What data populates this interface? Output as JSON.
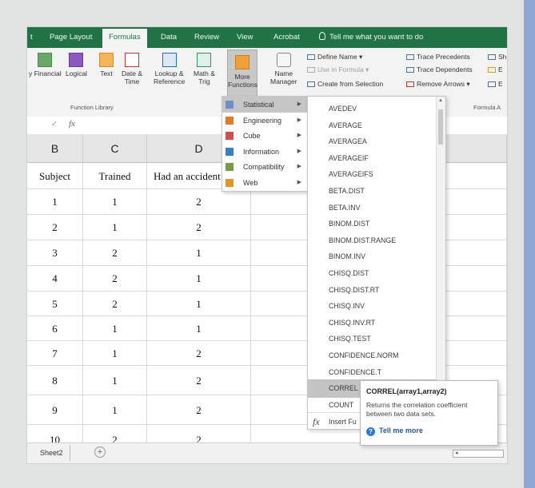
{
  "ribbon": {
    "tabs": [
      "t",
      "Page Layout",
      "Formulas",
      "Data",
      "Review",
      "View",
      "Acrobat"
    ],
    "active_tab": "Formulas",
    "tell_me": "Tell me what you want to do",
    "buttons": {
      "financial": "y Financial",
      "logical": "Logical",
      "text": "Text",
      "date_time_1": "Date &",
      "date_time_2": "Time",
      "lookup_1": "Lookup &",
      "lookup_2": "Reference",
      "math_1": "Math &",
      "math_2": "Trig",
      "more_1": "More",
      "more_2": "Functions",
      "name_mgr_1": "Name",
      "name_mgr_2": "Manager"
    },
    "defined_names": {
      "define": "Define Name",
      "use": "Use in Formula",
      "create": "Create from Selection"
    },
    "auditing": {
      "precedents": "Trace Precedents",
      "dependents": "Trace Dependents",
      "remove": "Remove Arrows",
      "sh": "Sh",
      "e1": "E",
      "e2": "E"
    },
    "group_labels": {
      "function_library": "Function Library",
      "formula_auditing": "Formula A"
    }
  },
  "formula_bar": {
    "check": "✓",
    "fx": "fx"
  },
  "grid": {
    "columns": [
      "B",
      "C",
      "D"
    ],
    "header": [
      "Subject",
      "Trained",
      "Had an accident"
    ],
    "rows": [
      [
        "1",
        "1",
        "2"
      ],
      [
        "2",
        "1",
        "2"
      ],
      [
        "3",
        "2",
        "1"
      ],
      [
        "4",
        "2",
        "1"
      ],
      [
        "5",
        "2",
        "1"
      ],
      [
        "6",
        "1",
        "1"
      ],
      [
        "7",
        "1",
        "2"
      ],
      [
        "8",
        "1",
        "2"
      ],
      [
        "9",
        "1",
        "2"
      ],
      [
        "10",
        "2",
        "2"
      ]
    ]
  },
  "more_functions_menu": [
    {
      "label": "Statistical",
      "icon": "statistical-icon",
      "color": "#6f8fc9"
    },
    {
      "label": "Engineering",
      "icon": "engineering-icon",
      "color": "#e07b2a"
    },
    {
      "label": "Cube",
      "icon": "cube-icon",
      "color": "#d05050"
    },
    {
      "label": "Information",
      "icon": "information-icon",
      "color": "#3a7fc1"
    },
    {
      "label": "Compatibility",
      "icon": "compatibility-icon",
      "color": "#7a9a4a"
    },
    {
      "label": "Web",
      "icon": "web-icon",
      "color": "#e0962a"
    }
  ],
  "statistical_functions": [
    "AVEDEV",
    "AVERAGE",
    "AVERAGEA",
    "AVERAGEIF",
    "AVERAGEIFS",
    "BETA.DIST",
    "BETA.INV",
    "BINOM.DIST",
    "BINOM.DIST.RANGE",
    "BINOM.INV",
    "CHISQ.DIST",
    "CHISQ.DIST.RT",
    "CHISQ.INV",
    "CHISQ.INV.RT",
    "CHISQ.TEST",
    "CONFIDENCE.NORM",
    "CONFIDENCE.T",
    "CORREL",
    "COUNT"
  ],
  "selected_function": "CORREL",
  "insert_function": "Insert Fu",
  "tooltip": {
    "title": "CORREL(array1,array2)",
    "description": "Returns the correlation coefficient between two data sets.",
    "link": "Tell me more"
  },
  "sheet_tab": "Sheet2",
  "colors": {
    "accent": "#217346",
    "selected": "#c4c4c4",
    "link": "#2b579a"
  }
}
